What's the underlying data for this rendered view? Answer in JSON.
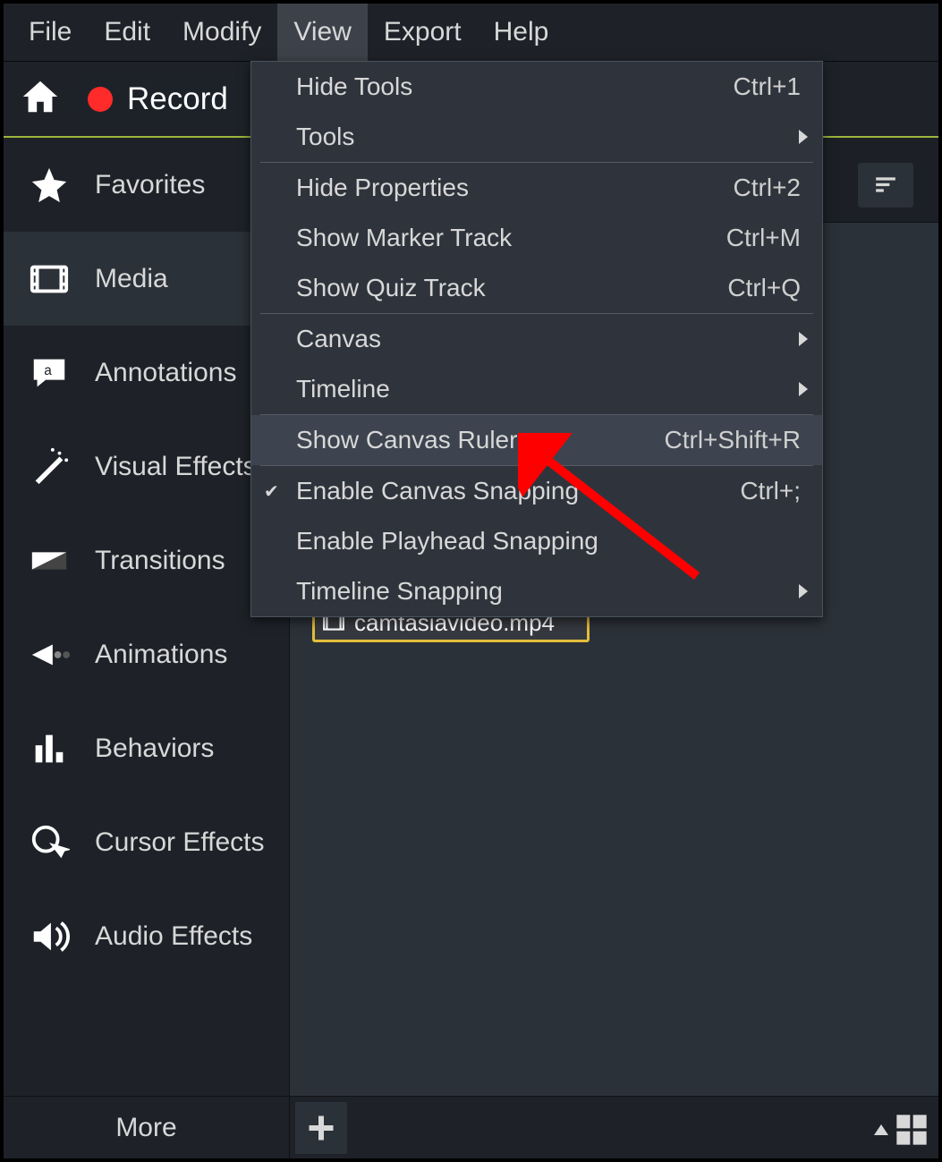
{
  "menubar": {
    "items": [
      {
        "label": "File"
      },
      {
        "label": "Edit"
      },
      {
        "label": "Modify"
      },
      {
        "label": "View"
      },
      {
        "label": "Export"
      },
      {
        "label": "Help"
      }
    ],
    "active_index": 3
  },
  "record": {
    "label": "Record"
  },
  "sidebar": {
    "items": [
      {
        "label": "Favorites",
        "icon": "star-icon"
      },
      {
        "label": "Media",
        "icon": "media-icon"
      },
      {
        "label": "Annotations",
        "icon": "annotations-icon"
      },
      {
        "label": "Visual Effects",
        "icon": "wand-icon"
      },
      {
        "label": "Transitions",
        "icon": "transitions-icon"
      },
      {
        "label": "Animations",
        "icon": "animations-icon"
      },
      {
        "label": "Behaviors",
        "icon": "behaviors-icon"
      },
      {
        "label": "Cursor Effects",
        "icon": "cursor-icon"
      },
      {
        "label": "Audio Effects",
        "icon": "audio-icon"
      }
    ],
    "active_index": 1,
    "more_label": "More"
  },
  "media": {
    "file_label": "camtasiavideo.mp4"
  },
  "view_menu": {
    "items": [
      {
        "label": "Hide Tools",
        "shortcut": "Ctrl+1"
      },
      {
        "label": "Tools",
        "submenu": true,
        "sep_after": true
      },
      {
        "label": "Hide Properties",
        "shortcut": "Ctrl+2"
      },
      {
        "label": "Show Marker Track",
        "shortcut": "Ctrl+M"
      },
      {
        "label": "Show Quiz Track",
        "shortcut": "Ctrl+Q",
        "sep_after": true
      },
      {
        "label": "Canvas",
        "submenu": true
      },
      {
        "label": "Timeline",
        "submenu": true,
        "sep_after": true
      },
      {
        "label": "Show Canvas Ruler",
        "shortcut": "Ctrl+Shift+R",
        "highlight": true,
        "sep_after": true
      },
      {
        "label": "Enable Canvas Snapping",
        "shortcut": "Ctrl+;",
        "checked": true
      },
      {
        "label": "Enable Playhead Snapping"
      },
      {
        "label": "Timeline Snapping",
        "submenu": true
      }
    ]
  }
}
